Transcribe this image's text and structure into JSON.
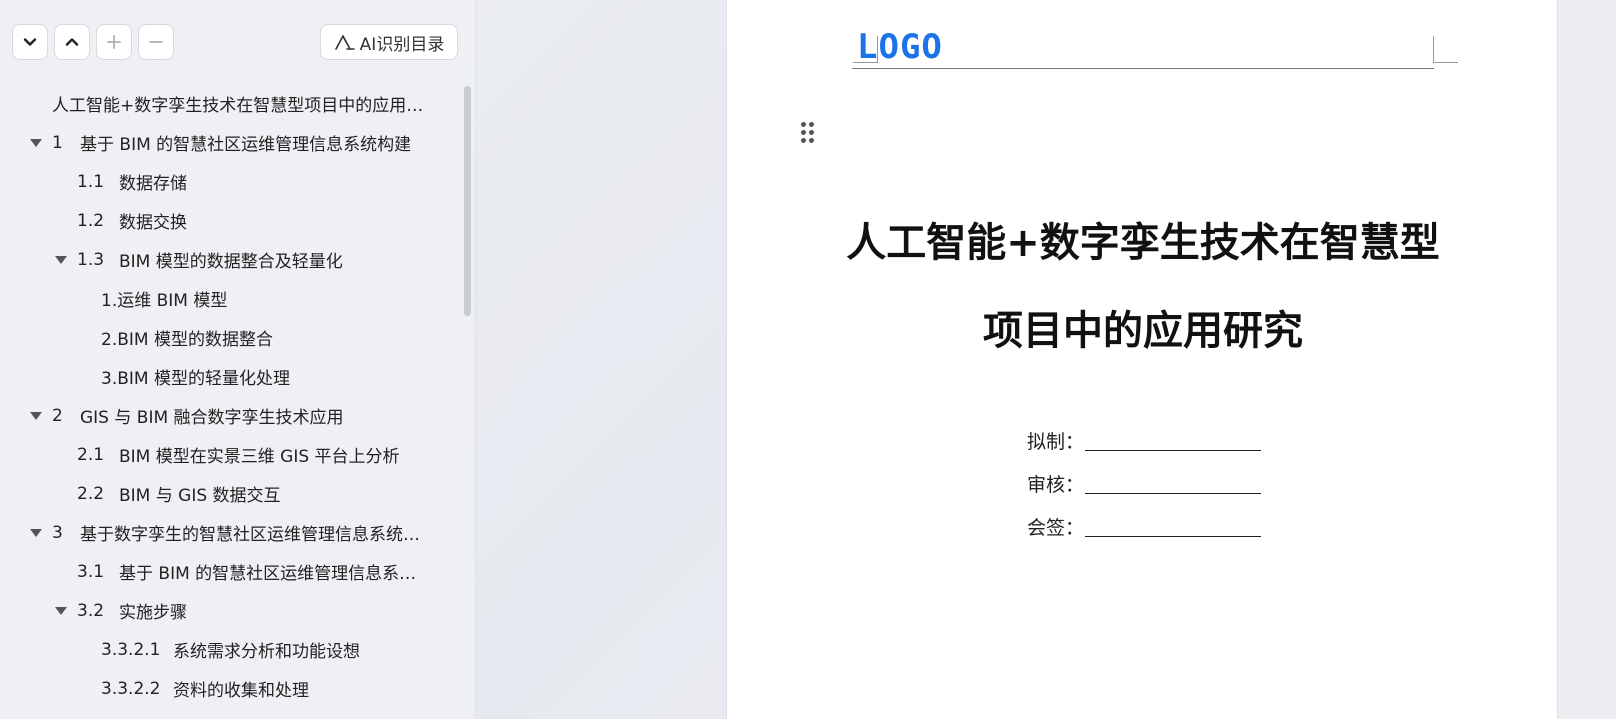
{
  "toolbar": {
    "buttons": [
      {
        "icon": "chevron-down-icon"
      },
      {
        "icon": "chevron-up-icon"
      },
      {
        "icon": "plus-icon"
      },
      {
        "icon": "minus-icon"
      }
    ],
    "ai_label": "AI识别目录"
  },
  "toc": [
    {
      "level": 0,
      "expanded": null,
      "num": "",
      "text": "人工智能+数字孪生技术在智慧型项目中的应用…"
    },
    {
      "level": 0,
      "expanded": true,
      "num": "1",
      "text": "基于 BIM 的智慧社区运维管理信息系统构建"
    },
    {
      "level": 1,
      "expanded": null,
      "num": "1.1",
      "text": "数据存储"
    },
    {
      "level": 1,
      "expanded": null,
      "num": "1.2",
      "text": "数据交换"
    },
    {
      "level": 1,
      "expanded": true,
      "num": "1.3",
      "text": "BIM 模型的数据整合及轻量化"
    },
    {
      "level": 2,
      "expanded": null,
      "num": "",
      "text": "1.运维 BIM 模型"
    },
    {
      "level": 2,
      "expanded": null,
      "num": "",
      "text": "2.BIM 模型的数据整合"
    },
    {
      "level": 2,
      "expanded": null,
      "num": "",
      "text": "3.BIM 模型的轻量化处理"
    },
    {
      "level": 0,
      "expanded": true,
      "num": "2",
      "text": "GIS 与 BIM 融合数字孪生技术应用"
    },
    {
      "level": 1,
      "expanded": null,
      "num": "2.1",
      "text": "BIM 模型在实景三维 GIS 平台上分析"
    },
    {
      "level": 1,
      "expanded": null,
      "num": "2.2",
      "text": "BIM 与 GIS 数据交互"
    },
    {
      "level": 0,
      "expanded": true,
      "num": "3",
      "text": "基于数字孪生的智慧社区运维管理信息系统…"
    },
    {
      "level": 1,
      "expanded": null,
      "num": "3.1",
      "text": "基于 BIM 的智慧社区运维管理信息系…"
    },
    {
      "level": 1,
      "expanded": true,
      "num": "3.2",
      "text": "实施步骤"
    },
    {
      "level": 2,
      "expanded": null,
      "num": "3.3.2.1",
      "text": "系统需求分析和功能设想"
    },
    {
      "level": 2,
      "expanded": null,
      "num": "3.3.2.2",
      "text": "资料的收集和处理"
    }
  ],
  "document": {
    "logo_text": "LOGO",
    "title_line1": "人工智能+数字孪生技术在智慧型",
    "title_line2": "项目中的应用研究",
    "sign_fields": [
      "拟制：",
      "审核：",
      "会签："
    ]
  },
  "colors": {
    "logo": "#1a73e8",
    "sidebar_bg": "#eef0f4",
    "page_bg": "#ffffff"
  }
}
